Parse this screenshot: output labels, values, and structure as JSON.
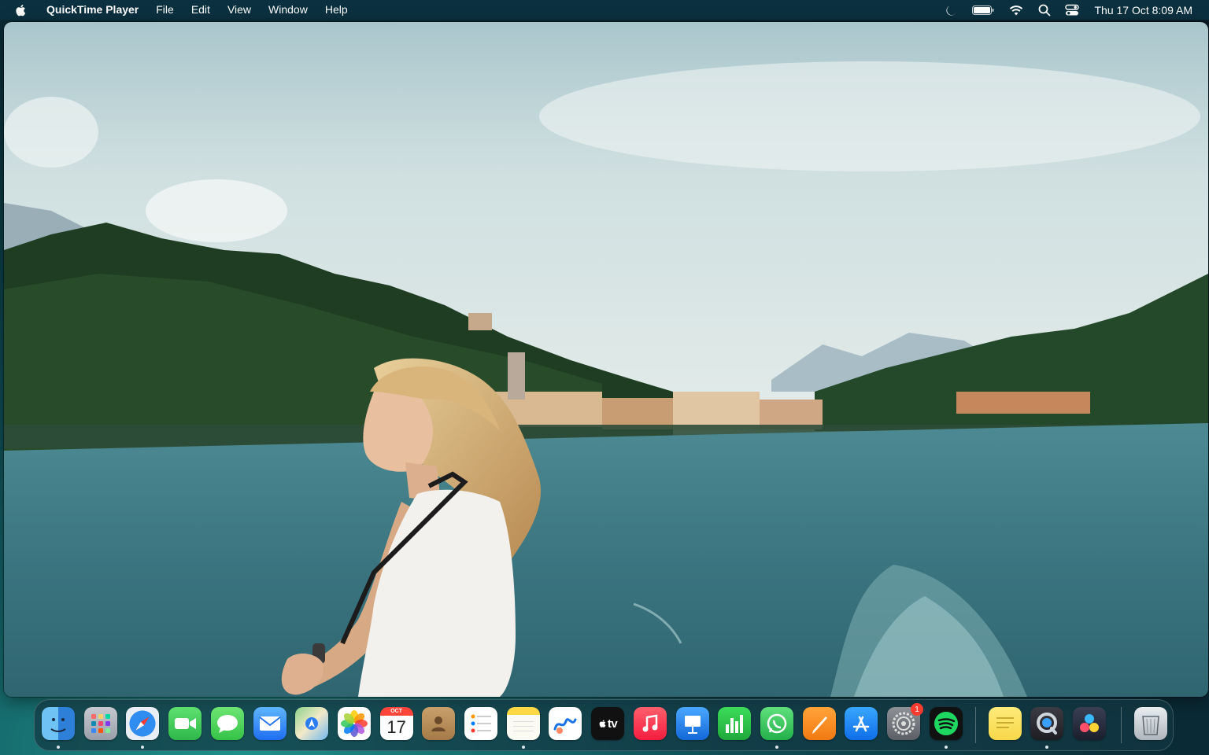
{
  "menubar": {
    "apple_icon": "apple-logo-icon",
    "app_name": "QuickTime Player",
    "menus": [
      "File",
      "Edit",
      "View",
      "Window",
      "Help"
    ],
    "status_icons": [
      "moon-focus-icon",
      "battery-icon",
      "wifi-icon",
      "spotlight-search-icon",
      "control-center-icon"
    ],
    "clock": "Thu 17 Oct  8:09 AM"
  },
  "video": {
    "content": "video-frame",
    "colors": {
      "sky": "#d6e4e6",
      "water": "#3f7a86",
      "hills": "#1f3f24"
    }
  },
  "dock": {
    "apps": [
      {
        "name": "Finder",
        "icon": "finder-icon",
        "running": true
      },
      {
        "name": "Launchpad",
        "icon": "launchpad-icon",
        "running": false
      },
      {
        "name": "Safari",
        "icon": "safari-icon",
        "running": true
      },
      {
        "name": "FaceTime",
        "icon": "facetime-icon",
        "running": false
      },
      {
        "name": "Messages",
        "icon": "messages-icon",
        "running": false
      },
      {
        "name": "Mail",
        "icon": "mail-icon",
        "running": false
      },
      {
        "name": "Maps",
        "icon": "maps-icon",
        "running": false
      },
      {
        "name": "Photos",
        "icon": "photos-icon",
        "running": false
      },
      {
        "name": "Calendar",
        "icon": "calendar-icon",
        "running": false,
        "month": "OCT",
        "day": "17"
      },
      {
        "name": "Contacts",
        "icon": "contacts-icon",
        "running": false
      },
      {
        "name": "Reminders",
        "icon": "reminders-icon",
        "running": false
      },
      {
        "name": "Notes",
        "icon": "notes-icon",
        "running": true
      },
      {
        "name": "Freeform",
        "icon": "freeform-icon",
        "running": false
      },
      {
        "name": "TV",
        "icon": "apple-tv-icon",
        "running": false,
        "label": "tv"
      },
      {
        "name": "Music",
        "icon": "music-icon",
        "running": false
      },
      {
        "name": "Keynote",
        "icon": "keynote-icon",
        "running": false
      },
      {
        "name": "Numbers",
        "icon": "numbers-icon",
        "running": false
      },
      {
        "name": "WhatsApp",
        "icon": "whatsapp-icon",
        "running": true
      },
      {
        "name": "Pages",
        "icon": "pages-icon",
        "running": false
      },
      {
        "name": "App Store",
        "icon": "app-store-icon",
        "running": false
      },
      {
        "name": "System Settings",
        "icon": "system-settings-icon",
        "running": false,
        "badge": "1"
      },
      {
        "name": "Spotify",
        "icon": "spotify-icon",
        "running": true
      },
      {
        "name": "Stickies",
        "icon": "stickies-icon",
        "running": false
      },
      {
        "name": "QuickTime Player",
        "icon": "quicktime-icon",
        "running": true
      },
      {
        "name": "DaVinci Resolve",
        "icon": "davinci-resolve-icon",
        "running": false
      },
      {
        "name": "Trash",
        "icon": "trash-icon",
        "running": false
      }
    ]
  }
}
